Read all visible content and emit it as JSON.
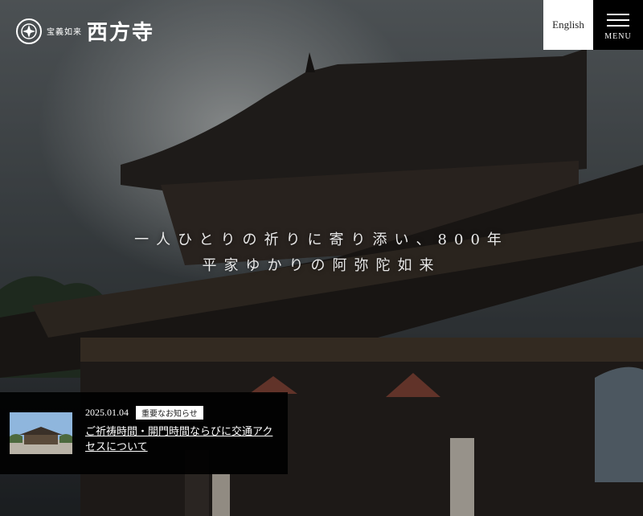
{
  "header": {
    "logo_sub": "宝義如来",
    "logo_main": "西方寺",
    "english_label": "English",
    "menu_label": "MENU"
  },
  "hero": {
    "tagline_1": "一人ひとりの祈りに寄り添い、800年",
    "tagline_2": "平家ゆかりの阿弥陀如来"
  },
  "news": {
    "date": "2025.01.04",
    "badge": "重要なお知らせ",
    "title": "ご祈祷時間・開門時間ならびに交通アクセスについて"
  },
  "colors": {
    "header_button_bg": "#ffffff",
    "menu_bg": "#000000",
    "news_bg": "#000000"
  }
}
